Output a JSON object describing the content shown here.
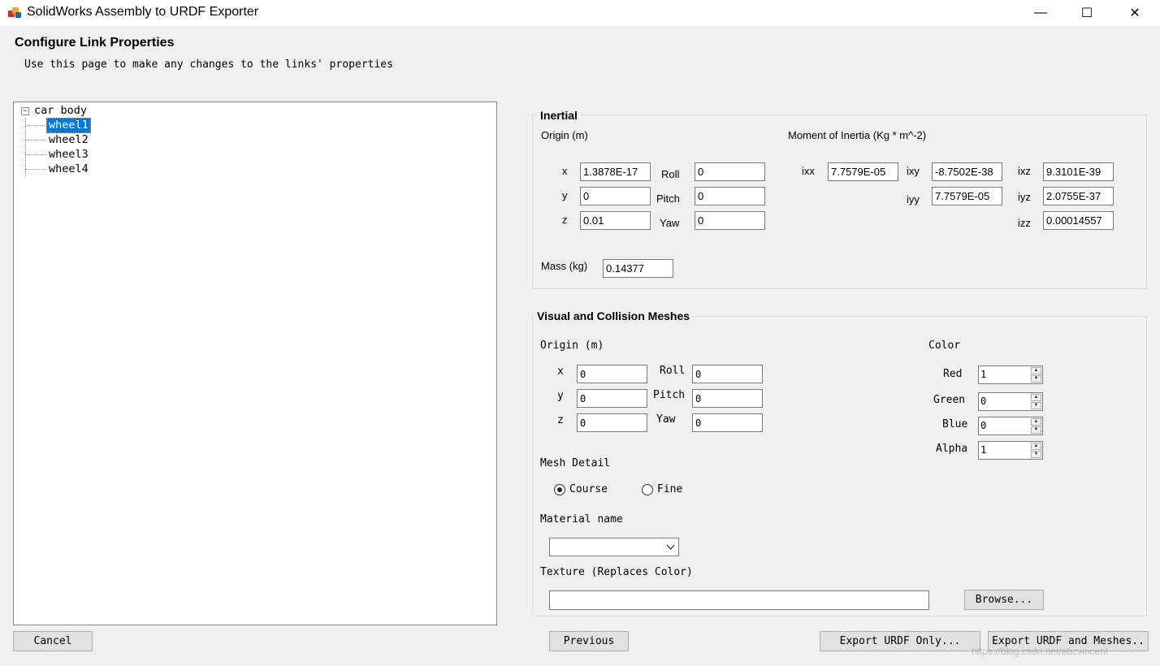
{
  "window": {
    "title": "SolidWorks Assembly to URDF Exporter",
    "minimize": "—",
    "maximize": "☐",
    "close": "✕"
  },
  "page": {
    "title": "Configure Link Properties",
    "subtitle": "Use this page to make any changes to the links' properties"
  },
  "tree": {
    "root": "car body",
    "expander": "−",
    "children": [
      "wheel1",
      "wheel2",
      "wheel3",
      "wheel4"
    ],
    "selected": "wheel1"
  },
  "inertial": {
    "title": "Inertial",
    "origin_label": "Origin (m)",
    "moi_label": "Moment of Inertia (Kg * m^-2)",
    "x_label": "x",
    "y_label": "y",
    "z_label": "z",
    "x": "1.3878E-17",
    "y": "0",
    "z": "0.01",
    "roll_label": "Roll",
    "pitch_label": "Pitch",
    "yaw_label": "Yaw",
    "roll": "0",
    "pitch": "0",
    "yaw": "0",
    "ixx_label": "ixx",
    "ixy_label": "ixy",
    "ixz_label": "ixz",
    "iyy_label": "iyy",
    "iyz_label": "iyz",
    "izz_label": "izz",
    "ixx": "7.7579E-05",
    "ixy": "-8.7502E-38",
    "ixz": "9.3101E-39",
    "iyy": "7.7579E-05",
    "iyz": "2.0755E-37",
    "izz": "0.00014557",
    "mass_label": "Mass (kg)",
    "mass": "0.14377"
  },
  "visual": {
    "title": "Visual and Collision Meshes",
    "origin_label": "Origin (m)",
    "x_label": "x",
    "y_label": "y",
    "z_label": "z",
    "x": "0",
    "y": "0",
    "z": "0",
    "roll_label": "Roll",
    "pitch_label": "Pitch",
    "yaw_label": "Yaw",
    "roll": "0",
    "pitch": "0",
    "yaw": "0",
    "color_label": "Color",
    "red_label": "Red",
    "green_label": "Green",
    "blue_label": "Blue",
    "alpha_label": "Alpha",
    "red": "1",
    "green": "0",
    "blue": "0",
    "alpha": "1",
    "mesh_detail_label": "Mesh Detail",
    "course_label": "Course",
    "fine_label": "Fine",
    "mesh_detail_selected": "Course",
    "material_label": "Material name",
    "material_value": "",
    "texture_label": "Texture (Replaces Color)",
    "texture_value": "",
    "browse_label": "Browse..."
  },
  "footer": {
    "cancel": "Cancel",
    "previous": "Previous",
    "export_urdf": "Export URDF Only...",
    "export_urdf_meshes": "Export URDF and Meshes..",
    "watermark": "https://blog.csdn.net/abcvincent"
  }
}
